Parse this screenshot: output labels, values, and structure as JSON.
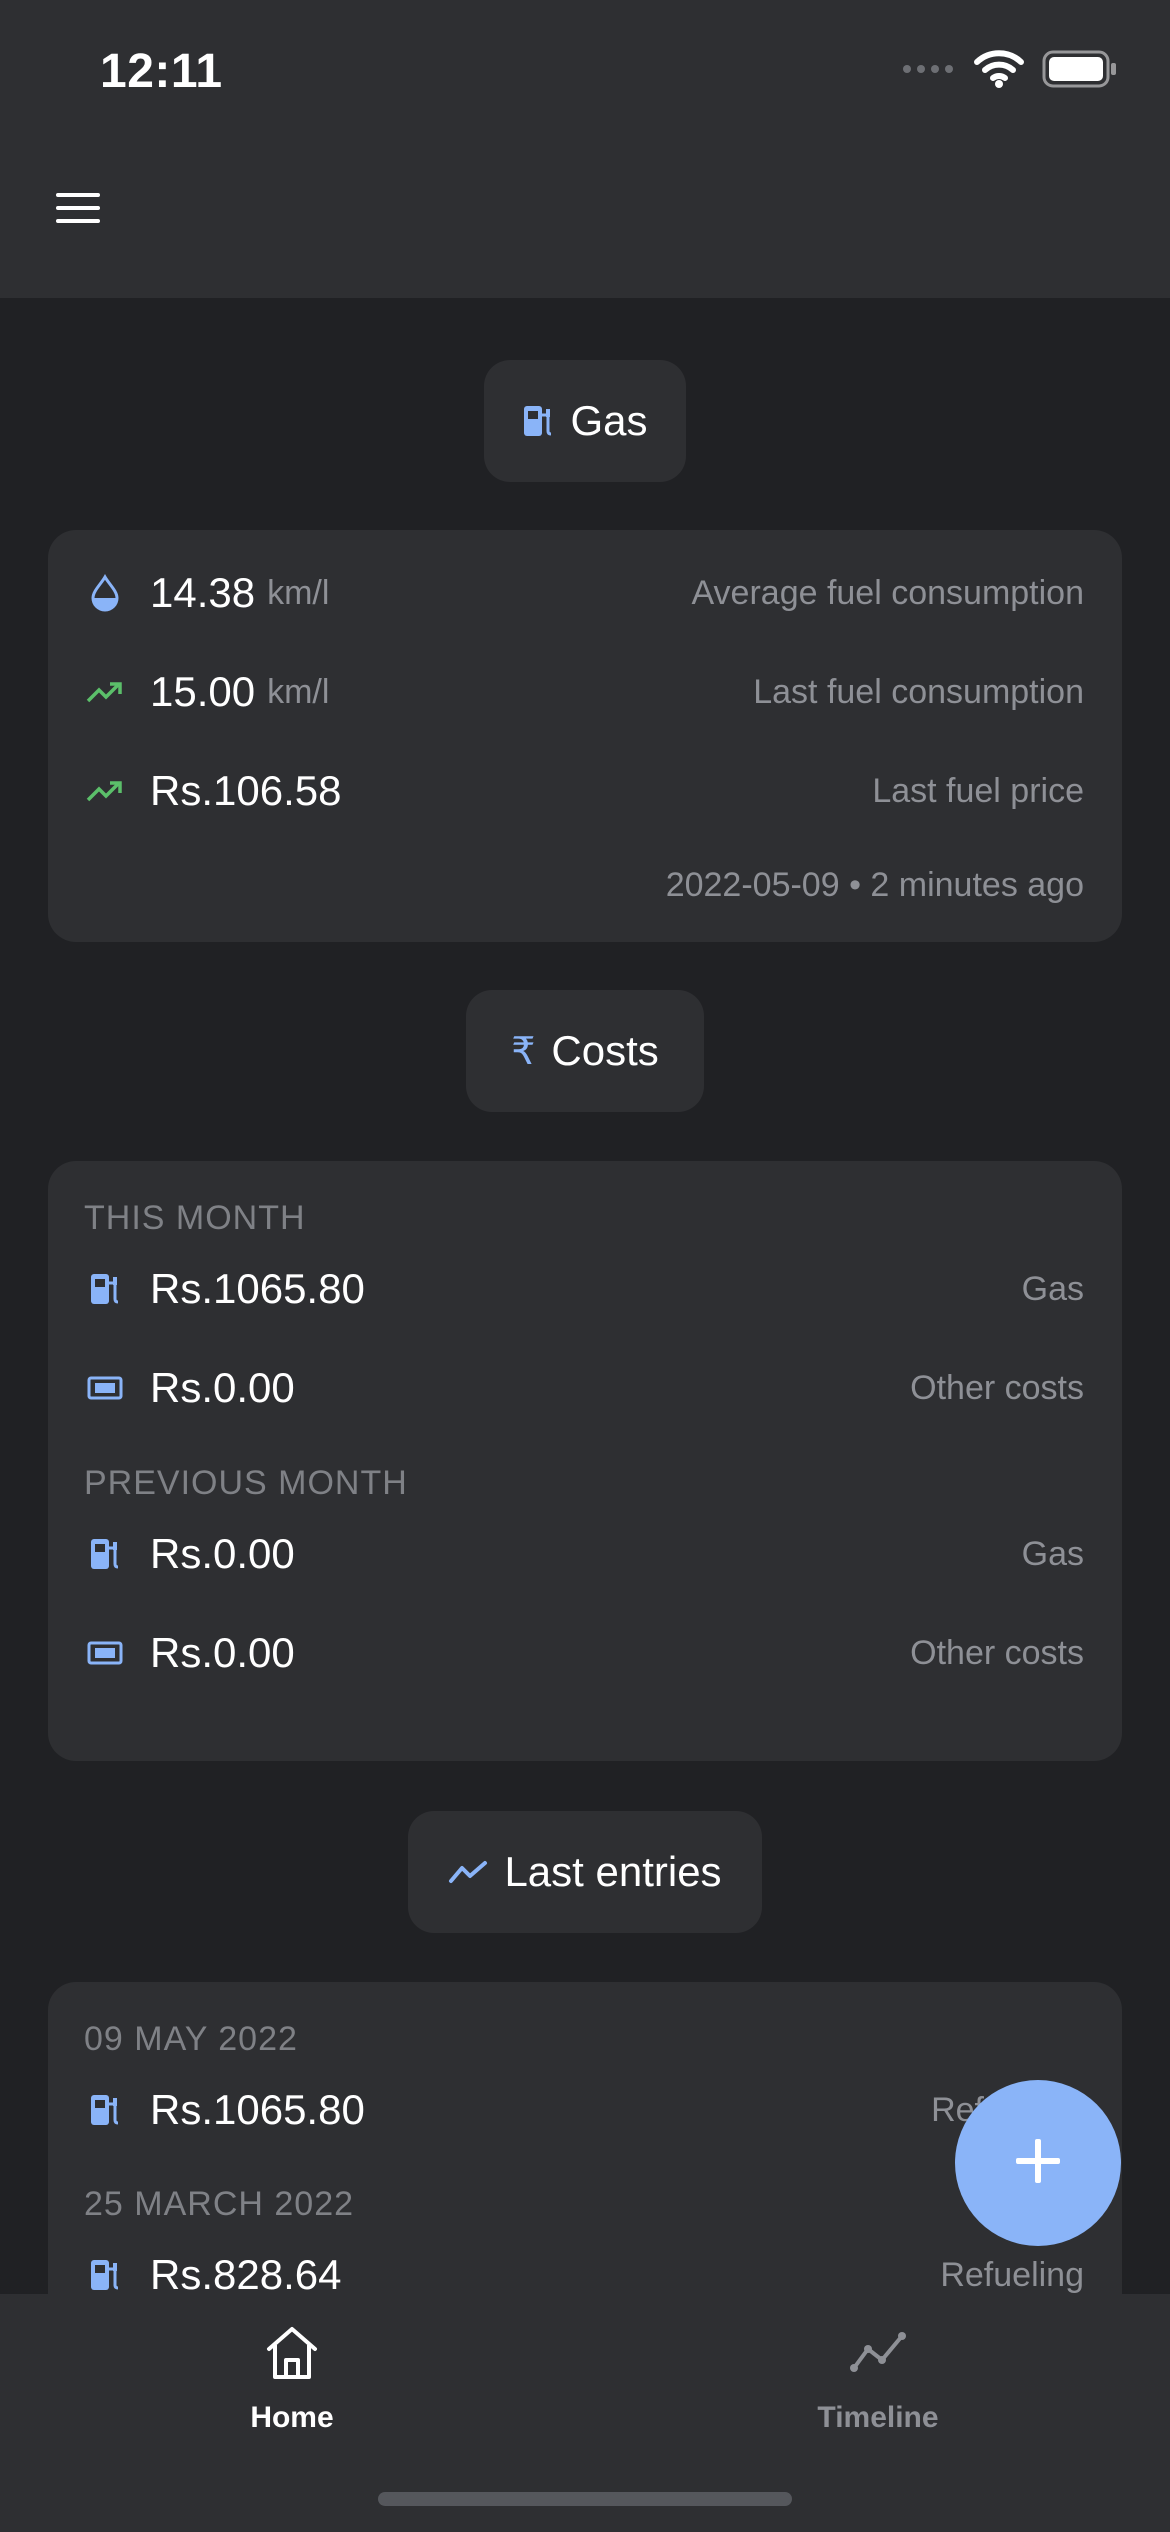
{
  "status_bar": {
    "time": "12:11"
  },
  "colors": {
    "background": "#202124",
    "surface": "#2e2f32",
    "accent": "#8ab4f8",
    "trend_up": "#5bbf6a",
    "muted_text": "#8e9096"
  },
  "app_bar": {
    "menu_icon": "hamburger-menu-icon"
  },
  "gas_section": {
    "chip_label": "Gas",
    "chip_icon": "fuel-pump-icon",
    "rows": [
      {
        "icon": "water-drop-icon",
        "value": "14.38",
        "unit": "km/l",
        "description": "Average fuel consumption"
      },
      {
        "icon": "trending-up-icon",
        "value": "15.00",
        "unit": "km/l",
        "description": "Last fuel consumption"
      },
      {
        "icon": "trending-up-icon",
        "value": "Rs.106.58",
        "unit": "",
        "description": "Last fuel price"
      }
    ],
    "footer": "2022-05-09 • 2 minutes ago"
  },
  "costs_section": {
    "chip_label": "Costs",
    "chip_icon": "rupee-icon",
    "groups": [
      {
        "label": "THIS MONTH",
        "rows": [
          {
            "icon": "fuel-pump-icon",
            "value": "Rs.1065.80",
            "description": "Gas"
          },
          {
            "icon": "banknote-icon",
            "value": "Rs.0.00",
            "description": "Other costs"
          }
        ]
      },
      {
        "label": "PREVIOUS MONTH",
        "rows": [
          {
            "icon": "fuel-pump-icon",
            "value": "Rs.0.00",
            "description": "Gas"
          },
          {
            "icon": "banknote-icon",
            "value": "Rs.0.00",
            "description": "Other costs"
          }
        ]
      }
    ]
  },
  "entries_section": {
    "chip_label": "Last entries",
    "chip_icon": "timeline-icon",
    "entries": [
      {
        "date": "09 MAY 2022",
        "icon": "fuel-pump-icon",
        "value": "Rs.1065.80",
        "description": "Ref"
      },
      {
        "date": "25 MARCH 2022",
        "icon": "fuel-pump-icon",
        "value": "Rs.828.64",
        "description": "Refueling"
      }
    ]
  },
  "fab": {
    "icon": "plus-icon"
  },
  "bottom_nav": {
    "items": [
      {
        "label": "Home",
        "icon": "home-icon",
        "active": true
      },
      {
        "label": "Timeline",
        "icon": "timeline-icon",
        "active": false
      }
    ]
  }
}
